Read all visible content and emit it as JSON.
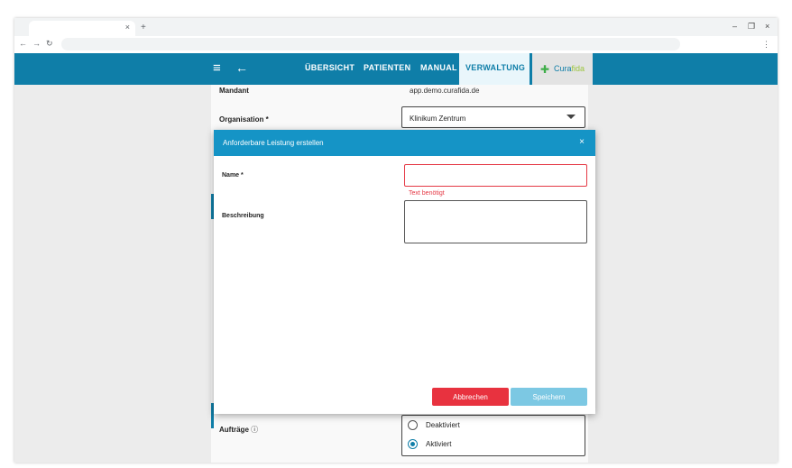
{
  "browser": {
    "tab_close": "×",
    "new_tab": "+",
    "minimize": "–",
    "restore": "❐",
    "close": "×",
    "back": "←",
    "forward": "→",
    "reload": "↻",
    "menu": "⋮"
  },
  "header": {
    "menu_icon": "≡",
    "back_icon": "←",
    "nav": [
      {
        "label": "ÜBERSICHT"
      },
      {
        "label": "PATIENTEN"
      },
      {
        "label": "MANUAL"
      },
      {
        "label": "VERWALTUNG"
      }
    ],
    "logo": {
      "mark": "✚",
      "part1": "Cura",
      "part2": "fida"
    }
  },
  "form": {
    "mandant_label": "Mandant",
    "mandant_value": "app.demo.curafida.de",
    "organisation_label": "Organisation *",
    "organisation_value": "Klinikum Zentrum",
    "auftraege_label": "Aufträge",
    "auftraege_info": "ⓘ",
    "options": [
      {
        "label": "Deaktiviert",
        "selected": false
      },
      {
        "label": "Aktiviert",
        "selected": true
      }
    ]
  },
  "dialog": {
    "title": "Anforderbare Leistung erstellen",
    "close": "×",
    "name_label": "Name *",
    "name_value": "",
    "name_error": "Text benötigt",
    "description_label": "Beschreibung",
    "description_value": "",
    "cancel_label": "Abbrechen",
    "save_label": "Speichern"
  },
  "colors": {
    "primary": "#0f7ea8",
    "dialog_header": "#1594c6",
    "error": "#e53945",
    "cancel": "#e8323f",
    "save_disabled": "#7cc8e3"
  }
}
